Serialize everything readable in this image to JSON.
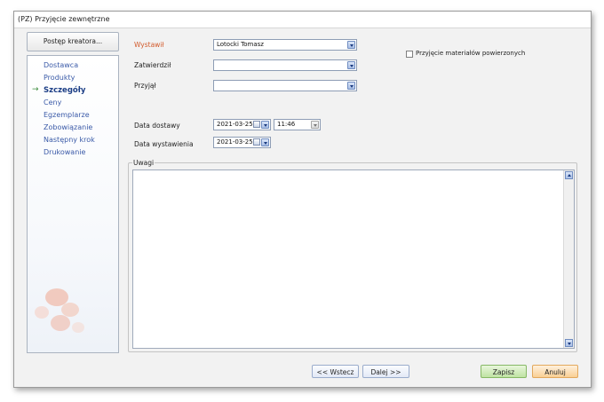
{
  "window": {
    "title": "(PZ) Przyjęcie zewnętrzne"
  },
  "wizard": {
    "header_button": "Postęp kreatora...",
    "steps": [
      {
        "label": "Dostawca",
        "active": false
      },
      {
        "label": "Produkty",
        "active": false
      },
      {
        "label": "Szczegóły",
        "active": true
      },
      {
        "label": "Ceny",
        "active": false
      },
      {
        "label": "Egzemplarze",
        "active": false
      },
      {
        "label": "Zobowiązanie",
        "active": false
      },
      {
        "label": "Następny krok",
        "active": false
      },
      {
        "label": "Drukowanie",
        "active": false
      }
    ],
    "active_marker": "→"
  },
  "form": {
    "wystawil": {
      "label": "Wystawił",
      "value": "Lotocki Tomasz"
    },
    "zatwierdzil": {
      "label": "Zatwierdził",
      "value": ""
    },
    "przyjal": {
      "label": "Przyjął",
      "value": ""
    },
    "przyjecie_materialow": {
      "label": "Przyjęcie materiałów powierzonych",
      "checked": false
    },
    "data_dostawy": {
      "label": "Data dostawy",
      "date": "2021-03-25",
      "time": "11:46"
    },
    "data_wystawienia": {
      "label": "Data wystawienia",
      "date": "2021-03-25"
    },
    "uwagi": {
      "label": "Uwagi",
      "value": ""
    }
  },
  "buttons": {
    "back": "<< Wstecz",
    "next": "Dalej >>",
    "save": "Zapisz",
    "cancel": "Anuluj"
  },
  "colors": {
    "required_label": "#d25a2b",
    "nav_link": "#3a5aa8",
    "save": "#bfe3a3",
    "cancel": "#f9cf94"
  }
}
